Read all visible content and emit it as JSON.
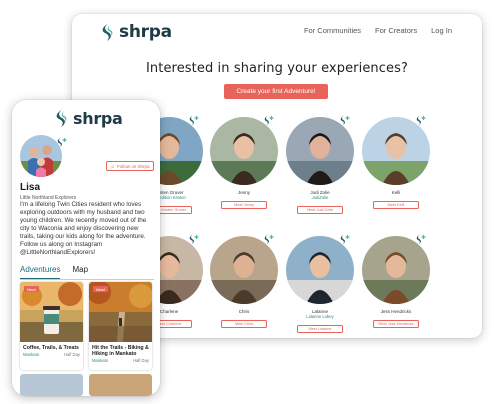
{
  "brand": {
    "name": "shrpa",
    "accent": "#e8645a",
    "teal": "#1f6b76"
  },
  "desktop": {
    "nav": [
      "For Communities",
      "For Creators",
      "Log In"
    ],
    "headline": "Interested in sharing your experiences?",
    "cta_label": "Create your first Adventure!",
    "creators": [
      {
        "name": "Kristen Gruver",
        "sub": "Expedition Kristen",
        "button": "Meet Kristen Gruver"
      },
      {
        "name": "Jenny",
        "sub": "",
        "button": "Meet Jenny"
      },
      {
        "name": "Judi Zolie",
        "sub": "JudiZolie",
        "button": "Meet Judi Zolie"
      },
      {
        "name": "Kelli",
        "sub": "",
        "button": "Meet Kelli"
      },
      {
        "name": "Charlene",
        "sub": "",
        "button": "Meet Charlene"
      },
      {
        "name": "Chris",
        "sub": "",
        "button": "Meet Chris"
      },
      {
        "name": "Lalanne",
        "sub": "Lalanne Lobey",
        "button": "Meet Lalanne"
      },
      {
        "name": "Jess Hendricks",
        "sub": "",
        "button": "Meet Jess Hendricks"
      }
    ]
  },
  "phone": {
    "follow_label": "Follow on Shrpa",
    "profile_name": "Lisa",
    "org": "Little Northland Explorers",
    "bio": "I'm a lifelong Twin Cities resident who loves exploring outdoors with my husband and two young children. We recently moved out of the city to Waconia and enjoy discovering new trails, taking our kids along for the adventure. Follow us along on Instagram @LittleNorthlandExplorers!",
    "tabs": [
      "Adventures",
      "Map"
    ],
    "adventures": [
      {
        "badge": "New!",
        "title": "Coffee, Trails, & Treats",
        "location": "Mankato",
        "duration": "Half Day"
      },
      {
        "badge": "New!",
        "title": "Hit the Trails - Biking & Hiking in Mankato",
        "location": "Mankato",
        "duration": "Half Day"
      }
    ]
  }
}
